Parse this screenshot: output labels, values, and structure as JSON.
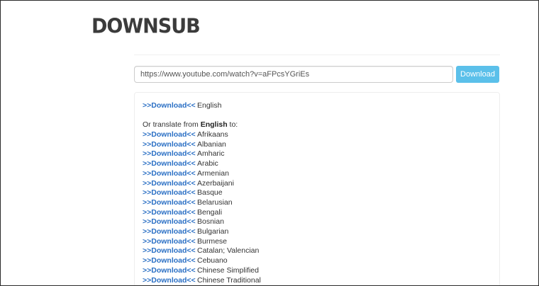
{
  "logo": {
    "text": "DOWNSUB"
  },
  "search": {
    "url_value": "https://www.youtube.com/watch?v=aFPcsYGriEs",
    "button_label": "Download"
  },
  "results": {
    "original": {
      "link_label": ">>Download<<",
      "language": "English"
    },
    "translate_prefix": "Or translate from ",
    "translate_source": "English",
    "translate_suffix": " to:",
    "link_label": ">>Download<<",
    "languages": [
      "Afrikaans",
      "Albanian",
      "Amharic",
      "Arabic",
      "Armenian",
      "Azerbaijani",
      "Basque",
      "Belarusian",
      "Bengali",
      "Bosnian",
      "Bulgarian",
      "Burmese",
      "Catalan; Valencian",
      "Cebuano",
      "Chinese Simplified",
      "Chinese Traditional"
    ]
  },
  "colors": {
    "button_bg": "#5bc0ea",
    "link": "#2a6fc4",
    "logo": "#3b3b3b"
  }
}
